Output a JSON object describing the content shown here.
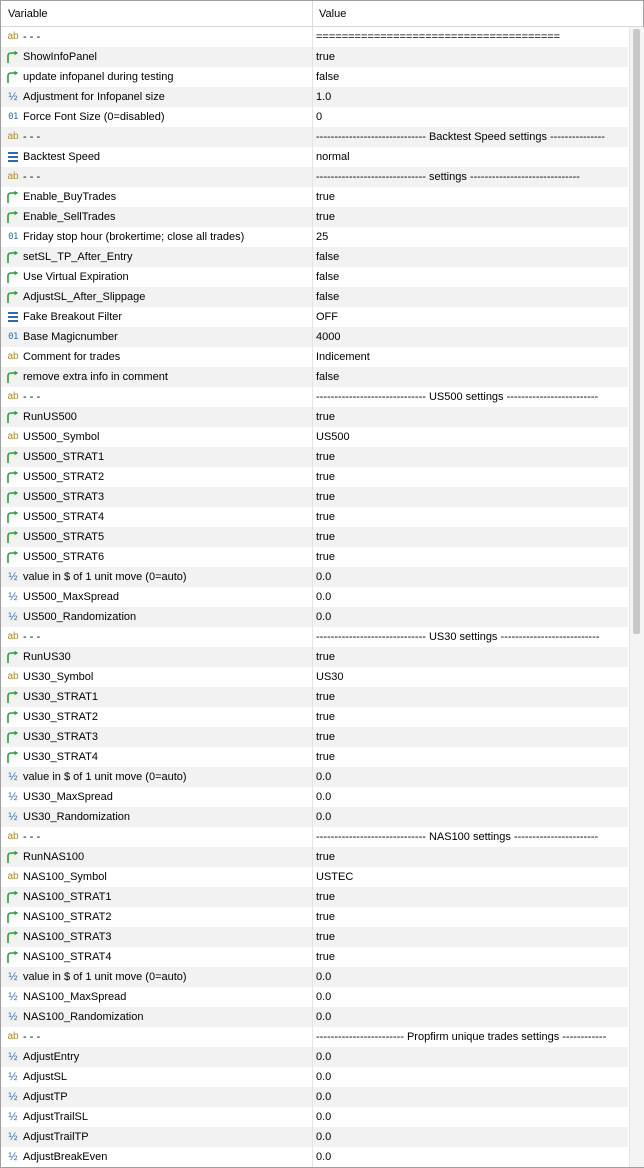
{
  "header": {
    "variable": "Variable",
    "value": "Value"
  },
  "rows": [
    {
      "icon": "ab",
      "name": "- - -",
      "value": "======================================"
    },
    {
      "icon": "bool",
      "name": "ShowInfoPanel",
      "value": "true"
    },
    {
      "icon": "bool",
      "name": "update infopanel during testing",
      "value": "false"
    },
    {
      "icon": "half",
      "name": "Adjustment for Infopanel size",
      "value": "1.0"
    },
    {
      "icon": "num",
      "name": "Force Font Size (0=disabled)",
      "value": "0"
    },
    {
      "icon": "ab",
      "name": "- - -",
      "value": "------------------------------ Backtest Speed settings ---------------"
    },
    {
      "icon": "enum",
      "name": "Backtest Speed",
      "value": "normal"
    },
    {
      "icon": "ab",
      "name": "- - -",
      "value": "------------------------------ settings ------------------------------"
    },
    {
      "icon": "bool",
      "name": "Enable_BuyTrades",
      "value": "true"
    },
    {
      "icon": "bool",
      "name": "Enable_SellTrades",
      "value": "true"
    },
    {
      "icon": "num",
      "name": "Friday stop hour (brokertime; close all trades)",
      "value": "25"
    },
    {
      "icon": "bool",
      "name": "setSL_TP_After_Entry",
      "value": "false"
    },
    {
      "icon": "bool",
      "name": "Use Virtual Expiration",
      "value": "false"
    },
    {
      "icon": "bool",
      "name": "AdjustSL_After_Slippage",
      "value": "false"
    },
    {
      "icon": "enum",
      "name": "Fake Breakout Filter",
      "value": "OFF"
    },
    {
      "icon": "num",
      "name": "Base Magicnumber",
      "value": "4000"
    },
    {
      "icon": "ab",
      "name": "Comment for trades",
      "value": "Indicement"
    },
    {
      "icon": "bool",
      "name": "remove extra info in comment",
      "value": "false"
    },
    {
      "icon": "ab",
      "name": "- - -",
      "value": "------------------------------ US500 settings -------------------------"
    },
    {
      "icon": "bool",
      "name": "RunUS500",
      "value": "true"
    },
    {
      "icon": "ab",
      "name": "US500_Symbol",
      "value": "US500"
    },
    {
      "icon": "bool",
      "name": "US500_STRAT1",
      "value": "true"
    },
    {
      "icon": "bool",
      "name": "US500_STRAT2",
      "value": "true"
    },
    {
      "icon": "bool",
      "name": "US500_STRAT3",
      "value": "true"
    },
    {
      "icon": "bool",
      "name": "US500_STRAT4",
      "value": "true"
    },
    {
      "icon": "bool",
      "name": "US500_STRAT5",
      "value": "true"
    },
    {
      "icon": "bool",
      "name": "US500_STRAT6",
      "value": "true"
    },
    {
      "icon": "half",
      "name": "value in $ of 1 unit move (0=auto)",
      "value": "0.0"
    },
    {
      "icon": "half",
      "name": "US500_MaxSpread",
      "value": "0.0"
    },
    {
      "icon": "half",
      "name": "US500_Randomization",
      "value": "0.0"
    },
    {
      "icon": "ab",
      "name": "- - -",
      "value": "------------------------------ US30 settings ---------------------------"
    },
    {
      "icon": "bool",
      "name": "RunUS30",
      "value": "true"
    },
    {
      "icon": "ab",
      "name": "US30_Symbol",
      "value": "US30"
    },
    {
      "icon": "bool",
      "name": "US30_STRAT1",
      "value": "true"
    },
    {
      "icon": "bool",
      "name": "US30_STRAT2",
      "value": "true"
    },
    {
      "icon": "bool",
      "name": "US30_STRAT3",
      "value": "true"
    },
    {
      "icon": "bool",
      "name": "US30_STRAT4",
      "value": "true"
    },
    {
      "icon": "half",
      "name": "value in $ of 1 unit move (0=auto)",
      "value": "0.0"
    },
    {
      "icon": "half",
      "name": "US30_MaxSpread",
      "value": "0.0"
    },
    {
      "icon": "half",
      "name": "US30_Randomization",
      "value": "0.0"
    },
    {
      "icon": "ab",
      "name": "- - -",
      "value": "------------------------------ NAS100 settings -----------------------"
    },
    {
      "icon": "bool",
      "name": "RunNAS100",
      "value": "true"
    },
    {
      "icon": "ab",
      "name": "NAS100_Symbol",
      "value": "USTEC"
    },
    {
      "icon": "bool",
      "name": "NAS100_STRAT1",
      "value": "true"
    },
    {
      "icon": "bool",
      "name": "NAS100_STRAT2",
      "value": "true"
    },
    {
      "icon": "bool",
      "name": "NAS100_STRAT3",
      "value": "true"
    },
    {
      "icon": "bool",
      "name": "NAS100_STRAT4",
      "value": "true"
    },
    {
      "icon": "half",
      "name": "value in $ of 1 unit move (0=auto)",
      "value": "0.0"
    },
    {
      "icon": "half",
      "name": "NAS100_MaxSpread",
      "value": "0.0"
    },
    {
      "icon": "half",
      "name": "NAS100_Randomization",
      "value": "0.0"
    },
    {
      "icon": "ab",
      "name": "- - -",
      "value": "------------------------ Propfirm unique trades settings ------------"
    },
    {
      "icon": "half",
      "name": "AdjustEntry",
      "value": "0.0"
    },
    {
      "icon": "half",
      "name": "AdjustSL",
      "value": "0.0"
    },
    {
      "icon": "half",
      "name": "AdjustTP",
      "value": "0.0"
    },
    {
      "icon": "half",
      "name": "AdjustTrailSL",
      "value": "0.0"
    },
    {
      "icon": "half",
      "name": "AdjustTrailTP",
      "value": "0.0"
    },
    {
      "icon": "half",
      "name": "AdjustBreakEven",
      "value": "0.0"
    }
  ],
  "colors": {
    "bool_icon": "#2e9e3a",
    "string_icon": "#b08a2c",
    "numeric_icon": "#2b6bb0",
    "row_alt": "#f2f2f2"
  }
}
